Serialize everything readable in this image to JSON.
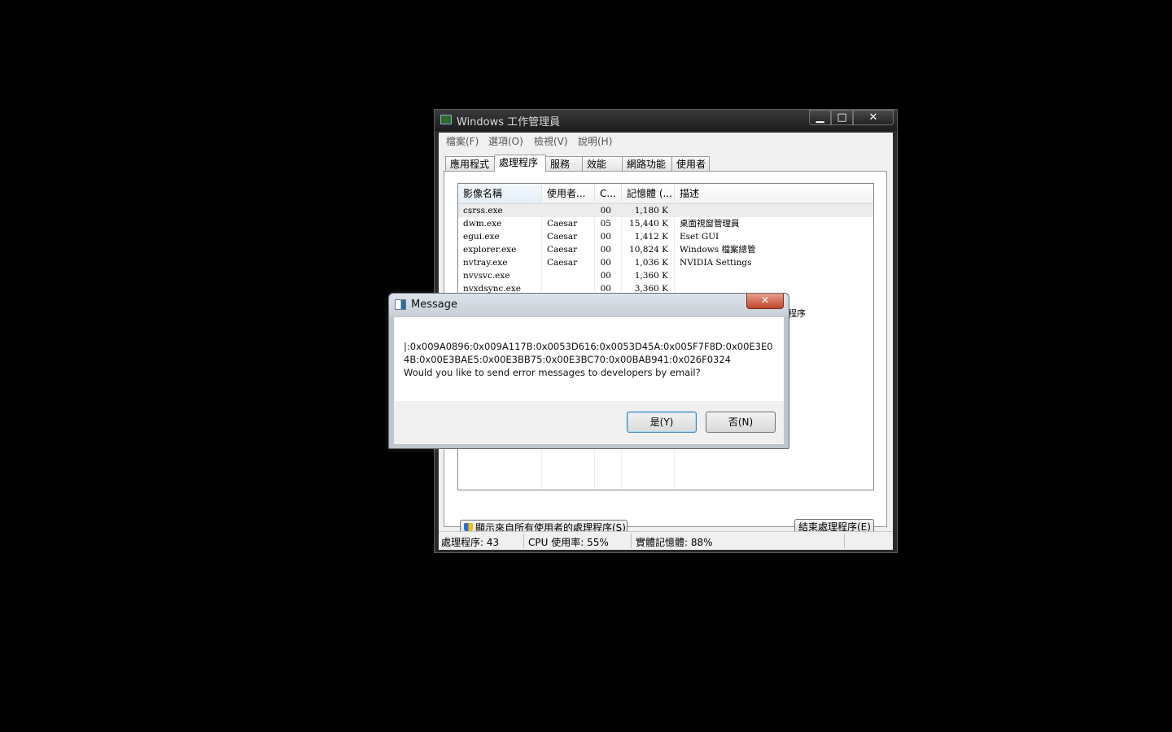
{
  "task_manager": {
    "title": "Windows 工作管理員",
    "menu": [
      "檔案(F)",
      "選項(O)",
      "檢視(V)",
      "說明(H)"
    ],
    "tabs": [
      "應用程式",
      "處理程序",
      "服務",
      "效能",
      "網路功能",
      "使用者"
    ],
    "active_tab": "處理程序",
    "columns": [
      "影像名稱",
      "使用者...",
      "C...",
      "記憶體 (...",
      "描述"
    ],
    "rows": [
      {
        "name": "csrss.exe",
        "user": "",
        "cpu": "00",
        "mem": "1,180 K",
        "desc": ""
      },
      {
        "name": "dwm.exe",
        "user": "Caesar",
        "cpu": "05",
        "mem": "15,440 K",
        "desc": "桌面視窗管理員"
      },
      {
        "name": "egui.exe",
        "user": "Caesar",
        "cpu": "00",
        "mem": "1,412 K",
        "desc": "Eset GUI"
      },
      {
        "name": "explorer.exe",
        "user": "Caesar",
        "cpu": "00",
        "mem": "10,824 K",
        "desc": "Windows 檔案總管"
      },
      {
        "name": "nvtray.exe",
        "user": "Caesar",
        "cpu": "00",
        "mem": "1,036 K",
        "desc": "NVIDIA Settings"
      },
      {
        "name": "nvvsvc.exe",
        "user": "",
        "cpu": "00",
        "mem": "1,360 K",
        "desc": ""
      },
      {
        "name": "nvxdsync.exe",
        "user": "",
        "cpu": "00",
        "mem": "3,360 K",
        "desc": ""
      }
    ],
    "partial_text": "程序",
    "show_all_button": "顯示來自所有使用者的處理程序(S)",
    "end_process_button": "結束處理程序(E)",
    "status": {
      "processes": "處理程序: 43",
      "cpu": "CPU 使用率: 55%",
      "memory": "實體記憶體: 88%"
    }
  },
  "dialog": {
    "title": "Message",
    "close_glyph": "✕",
    "lines": [
      "|:0x009A0896:0x009A117B:0x0053D616:0x0053D45A:0x005F7F8D:0x00E3E0",
      "4B:0x00E3BAE5:0x00E3BB75:0x00E3BC70:0x00BAB941:0x026F0324",
      "Would you like to send error messages to developers by email?"
    ],
    "yes_button": "是(Y)",
    "no_button": "否(N)"
  }
}
